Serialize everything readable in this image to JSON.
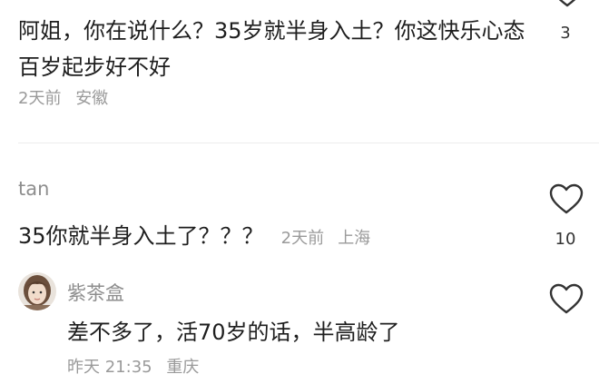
{
  "comments": [
    {
      "text": "阿姐，你在说什么？35岁就半身入土？你这快乐心态百岁起步好不好",
      "time": "2天前",
      "location": "安徽",
      "like_count": "3"
    },
    {
      "username": "tan",
      "text": "35你就半身入土了？？？",
      "time": "2天前",
      "location": "上海",
      "like_count": "10"
    }
  ],
  "reply": {
    "username": "紫茶盒",
    "text": "差不多了，活70岁的话，半高龄了",
    "time": "昨天 21:35",
    "location": "重庆"
  },
  "icons": {
    "like": "heart-outline-icon"
  },
  "colors": {
    "text_primary": "#1e1e1e",
    "text_secondary": "#9a9a9a",
    "username": "#8e8e8e",
    "divider": "#ececec"
  }
}
